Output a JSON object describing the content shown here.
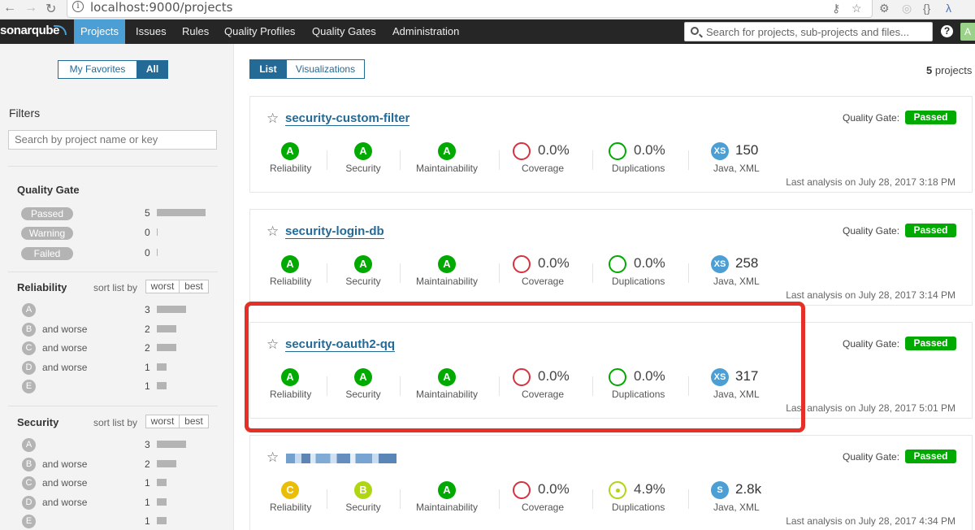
{
  "browser": {
    "url": "localhost:9000/projects"
  },
  "nav": {
    "logo": "sonarqube",
    "items": [
      "Projects",
      "Issues",
      "Rules",
      "Quality Profiles",
      "Quality Gates",
      "Administration"
    ],
    "search_placeholder": "Search for projects, sub-projects and files...",
    "help": "?",
    "avatar": "A"
  },
  "sidebar": {
    "toggle": [
      "My Favorites",
      "All"
    ],
    "filters_title": "Filters",
    "search_placeholder": "Search by project name or key",
    "quality_gate": {
      "title": "Quality Gate",
      "rows": [
        {
          "label": "Passed",
          "count": "5",
          "fraction": 1.0
        },
        {
          "label": "Warning",
          "count": "0",
          "fraction": 0
        },
        {
          "label": "Failed",
          "count": "0",
          "fraction": 0
        }
      ]
    },
    "reliability": {
      "title": "Reliability",
      "sort_label": "sort list by",
      "sort_options": [
        "worst",
        "best"
      ],
      "rows": [
        {
          "grade": "A",
          "label": "",
          "count": "3",
          "fraction": 0.6
        },
        {
          "grade": "B",
          "label": "and worse",
          "count": "2",
          "fraction": 0.4
        },
        {
          "grade": "C",
          "label": "and worse",
          "count": "2",
          "fraction": 0.4
        },
        {
          "grade": "D",
          "label": "and worse",
          "count": "1",
          "fraction": 0.2
        },
        {
          "grade": "E",
          "label": "",
          "count": "1",
          "fraction": 0.2
        }
      ]
    },
    "security": {
      "title": "Security",
      "sort_label": "sort list by",
      "sort_options": [
        "worst",
        "best"
      ],
      "rows": [
        {
          "grade": "A",
          "label": "",
          "count": "3",
          "fraction": 0.6
        },
        {
          "grade": "B",
          "label": "and worse",
          "count": "2",
          "fraction": 0.4
        },
        {
          "grade": "C",
          "label": "and worse",
          "count": "1",
          "fraction": 0.2
        },
        {
          "grade": "D",
          "label": "and worse",
          "count": "1",
          "fraction": 0.2
        },
        {
          "grade": "E",
          "label": "",
          "count": "1",
          "fraction": 0.2
        }
      ]
    }
  },
  "main": {
    "view_toggle": [
      "List",
      "Visualizations"
    ],
    "project_count": "5",
    "project_count_suffix": "projects",
    "quality_gate_label": "Quality Gate:",
    "metric_labels": [
      "Reliability",
      "Security",
      "Maintainability",
      "Coverage",
      "Duplications"
    ],
    "projects": [
      {
        "name": "security-custom-filter",
        "gate": "Passed",
        "reliability": "A",
        "security": "A",
        "maintainability": "A",
        "coverage": "0.0%",
        "duplications": "0.0%",
        "size": "XS",
        "loc": "150",
        "languages": "Java, XML",
        "last_analysis": "Last analysis on July 28, 2017 3:18 PM"
      },
      {
        "name": "security-login-db",
        "gate": "Passed",
        "reliability": "A",
        "security": "A",
        "maintainability": "A",
        "coverage": "0.0%",
        "duplications": "0.0%",
        "size": "XS",
        "loc": "258",
        "languages": "Java, XML",
        "last_analysis": "Last analysis on July 28, 2017 3:14 PM"
      },
      {
        "name": "security-oauth2-qq",
        "gate": "Passed",
        "reliability": "A",
        "security": "A",
        "maintainability": "A",
        "coverage": "0.0%",
        "duplications": "0.0%",
        "size": "XS",
        "loc": "317",
        "languages": "Java, XML",
        "last_analysis": "Last analysis on July 28, 2017 5:01 PM"
      },
      {
        "name": "",
        "gate": "Passed",
        "reliability": "C",
        "security": "B",
        "maintainability": "A",
        "coverage": "0.0%",
        "duplications": "4.9%",
        "size": "S",
        "loc": "2.8k",
        "languages": "Java, XML",
        "last_analysis": "Last analysis on July 28, 2017 4:34 PM"
      }
    ]
  },
  "colors": {
    "grade_A": "#00aa00",
    "grade_B": "#b0d513",
    "grade_C": "#eabe06",
    "coverage_ring": "#d4333f",
    "duplication_ring_ok": "#00aa00",
    "duplication_ring_mid": "#b0d513",
    "accent": "#4b9fd5",
    "highlight": "#e43027"
  }
}
